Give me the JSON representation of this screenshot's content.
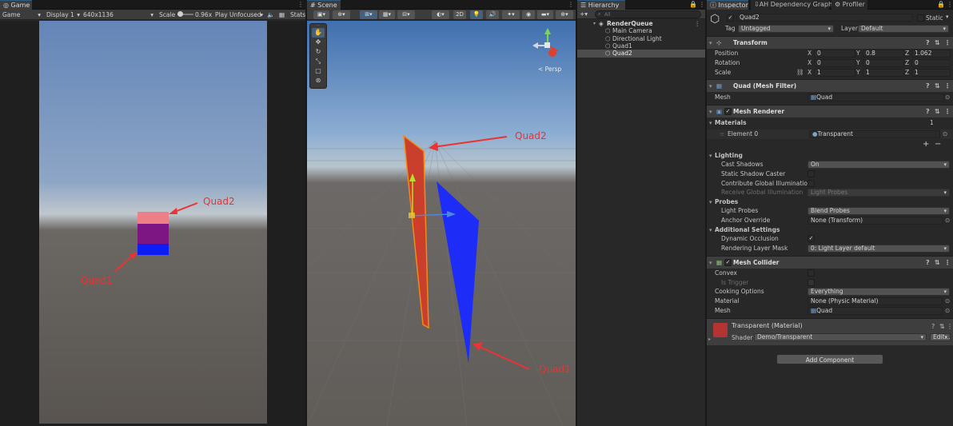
{
  "game": {
    "tab": "Game",
    "mode": "Game",
    "display": "Display 1",
    "resolution": "640x1136",
    "scale_label": "Scale",
    "scale_value": "0.96x",
    "play": "Play Unfocused",
    "stats": "Stats",
    "ann_quad2": "Quad2",
    "ann_quad1": "Quad1",
    "colors": {
      "quad2": "#ec7f88",
      "overlap": "#7d1683",
      "quad1": "#0c1ef3"
    }
  },
  "scene": {
    "tab": "Scene",
    "btn_2d": "2D",
    "persp": "< Persp",
    "ann_quad2": "Quad2",
    "ann_quad1": "Quad1",
    "colors": {
      "quad2": "#c93f2c",
      "quad1": "#1d2cf6"
    }
  },
  "hierarchy": {
    "tab": "Hierarchy",
    "search_placeholder": "All",
    "root": "RenderQueue",
    "items": [
      "Main Camera",
      "Directional Light",
      "Quad1",
      "Quad2"
    ]
  },
  "inspector": {
    "tabs": [
      "Inspector",
      "AH Dependency Graph",
      "Profiler"
    ],
    "object_name": "Quad2",
    "static_label": "Static",
    "tag_label": "Tag",
    "tag_value": "Untagged",
    "layer_label": "Layer",
    "layer_value": "Default",
    "transform": {
      "title": "Transform",
      "position_label": "Position",
      "rotation_label": "Rotation",
      "scale_label": "Scale",
      "position": {
        "x": "0",
        "y": "0.8",
        "z": "1.062"
      },
      "rotation": {
        "x": "0",
        "y": "0",
        "z": "0"
      },
      "scale": {
        "x": "1",
        "y": "1",
        "z": "1"
      }
    },
    "mesh_filter": {
      "title": "Quad (Mesh Filter)",
      "mesh_label": "Mesh",
      "mesh_value": "Quad"
    },
    "mesh_renderer": {
      "title": "Mesh Renderer",
      "materials_label": "Materials",
      "materials_count": "1",
      "element_label": "Element 0",
      "element_value": "Transparent",
      "lighting": "Lighting",
      "cast_shadows_label": "Cast Shadows",
      "cast_shadows_value": "On",
      "static_shadow_caster": "Static Shadow Caster",
      "contribute_gi": "Contribute Global Illumination",
      "receive_gi_label": "Receive Global Illumination",
      "receive_gi_value": "Light Probes",
      "probes": "Probes",
      "light_probes_label": "Light Probes",
      "light_probes_value": "Blend Probes",
      "anchor_label": "Anchor Override",
      "anchor_value": "None (Transform)",
      "additional": "Additional Settings",
      "dynamic_occlusion": "Dynamic Occlusion",
      "rendering_layer_label": "Rendering Layer Mask",
      "rendering_layer_value": "0: Light Layer default"
    },
    "mesh_collider": {
      "title": "Mesh Collider",
      "convex": "Convex",
      "is_trigger": "Is Trigger",
      "cooking_label": "Cooking Options",
      "cooking_value": "Everything",
      "material_label": "Material",
      "material_value": "None (Physic Material)",
      "mesh_label": "Mesh",
      "mesh_value": "Quad"
    },
    "material": {
      "title": "Transparent (Material)",
      "shader_label": "Shader",
      "shader_value": "Demo/Transparent",
      "edit": "Edit..."
    },
    "add_component": "Add Component"
  }
}
